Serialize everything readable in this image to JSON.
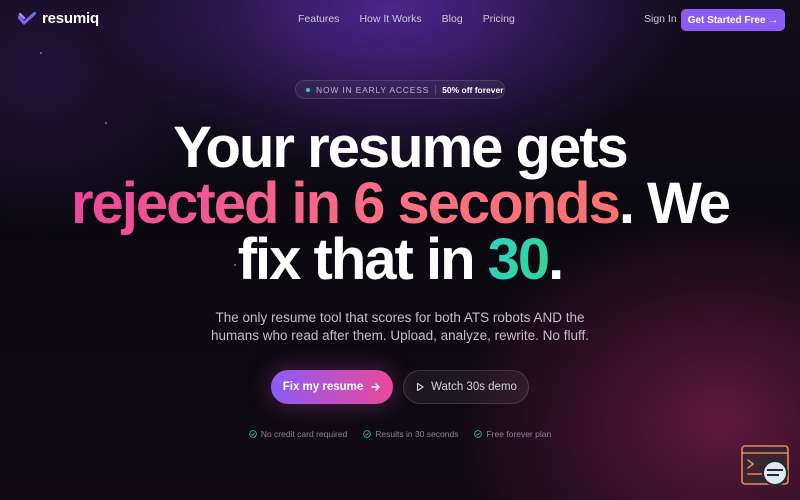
{
  "brand": {
    "name": "resumiq",
    "accent": "#8b5cf6"
  },
  "nav": {
    "links": [
      "Features",
      "How It Works",
      "Blog",
      "Pricing"
    ],
    "sign_in": "Sign In",
    "cta": "Get Started Free →"
  },
  "badge": {
    "label": "NOW IN EARLY ACCESS",
    "offer": "50% off forever"
  },
  "headline": {
    "line1": "Your resume gets",
    "highlight1": "rejected in 6 seconds",
    "line2_rest": ". We",
    "line3_pre": "fix that in ",
    "highlight2": "30",
    "line3_post": "."
  },
  "subheadline": "The only resume tool that scores for both ATS robots AND the humans who read after them. Upload, analyze, rewrite. No fluff.",
  "buttons": {
    "primary": "Fix my resume",
    "secondary": "Watch 30s demo"
  },
  "perks": [
    "No credit card required",
    "Results in 30 seconds",
    "Free forever plan"
  ],
  "icons": {
    "logo": "logo-check-icon",
    "arrow": "arrow-right-icon",
    "play": "play-icon",
    "check": "check-circle-icon",
    "widget": "chat-widget-icon"
  }
}
